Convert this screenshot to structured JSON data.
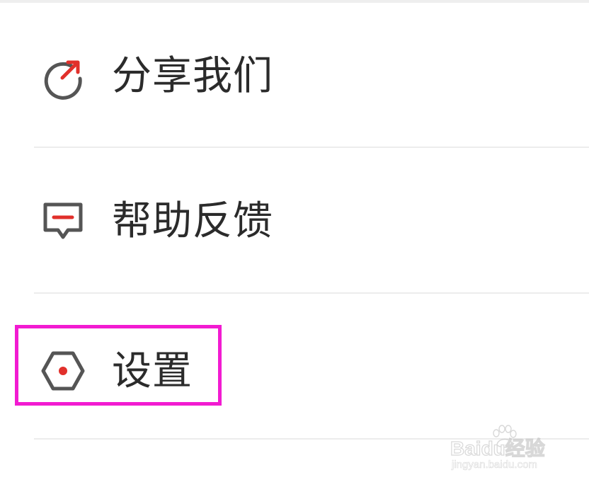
{
  "menu": {
    "items": [
      {
        "label": "分享我们",
        "icon": "share-icon"
      },
      {
        "label": "帮助反馈",
        "icon": "feedback-icon"
      },
      {
        "label": "设置",
        "icon": "settings-icon"
      }
    ]
  },
  "annotation": {
    "highlight_color": "#f21bd1"
  },
  "watermark": {
    "brand_logo_text": "Baidu经验",
    "url": "jingyan.baidu.com"
  },
  "colors": {
    "icon_gray": "#555555",
    "icon_accent": "#e1302b",
    "text": "#2b2b2b",
    "divider": "#ececec"
  }
}
